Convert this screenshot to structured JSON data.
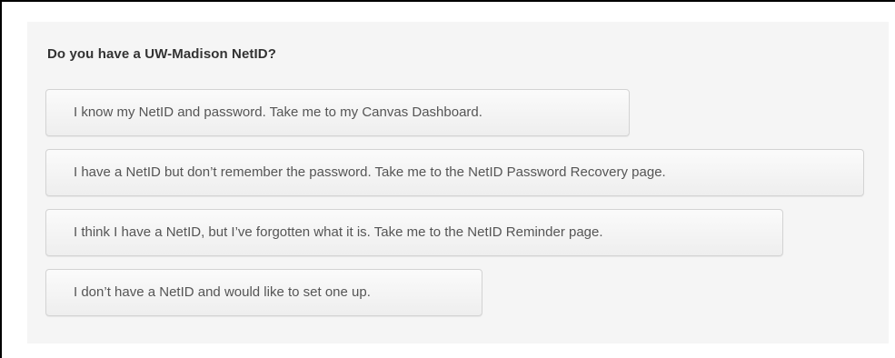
{
  "question": "Do you have a UW-Madison NetID?",
  "options": [
    "I know my NetID and password. Take me to my Canvas Dashboard.",
    "I have a NetID but don’t remember the password. Take me to the NetID Password Recovery page.",
    "I think I have a NetID, but I’ve forgotten what it is. Take me to the NetID Reminder page.",
    "I don’t have a NetID and would like to set one up."
  ],
  "colors": {
    "panel_background": "#f5f5f5",
    "button_border": "#d3d3d3",
    "button_text": "#555555",
    "question_text": "#333333"
  }
}
